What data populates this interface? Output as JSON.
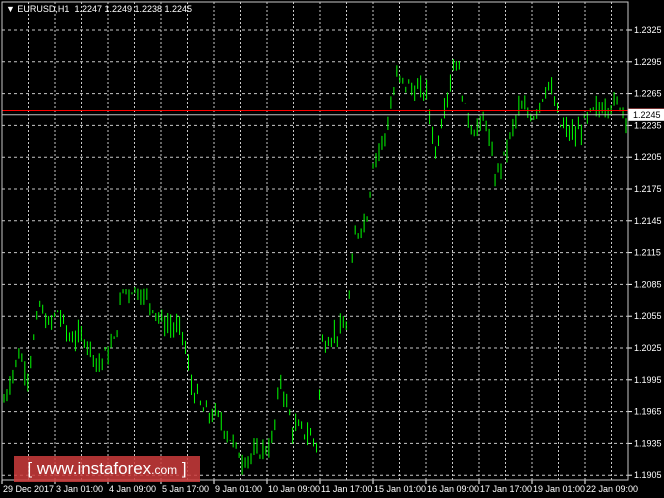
{
  "header": {
    "arrow_icon": "triangle-down",
    "symbol": "EURUSD,H1",
    "ohlc": "1.2247 1.2249 1.2238 1.2245"
  },
  "watermark": {
    "open": "[",
    "site": "www.instaforex",
    "tld": ".com",
    "close": "]"
  },
  "colors": {
    "bars": "#00ff00",
    "grid": "#c8c8c8",
    "ask_line": "#ff0000",
    "bid_line": "#c0c0c0",
    "watermark": "#cd3c3c"
  },
  "chart_data": {
    "type": "bar",
    "title": "EURUSD,H1",
    "ylim": [
      1.1905,
      1.2345
    ],
    "yticks": [
      "1.2325",
      "1.2295",
      "1.2265",
      "1.2235",
      "1.2205",
      "1.2175",
      "1.2145",
      "1.2115",
      "1.2085",
      "1.2055",
      "1.2025",
      "1.1995",
      "1.1965",
      "1.1935",
      "1.1905"
    ],
    "xticks": [
      "29 Dec 2017",
      "3 Jan 01:00",
      "4 Jan 09:00",
      "5 Jan 17:00",
      "9 Jan 01:00",
      "10 Jan 09:00",
      "11 Jan 17:00",
      "15 Jan 01:00",
      "16 Jan 09:00",
      "17 Jan 17:00",
      "19 Jan 01:00",
      "22 Jan 09:00"
    ],
    "current_price": "1.2245",
    "ask_price": 1.2249,
    "total_bars": 209,
    "close_keypoints": [
      [
        0,
        1.1975
      ],
      [
        5,
        1.202
      ],
      [
        8,
        1.2
      ],
      [
        12,
        1.2065
      ],
      [
        15,
        1.2045
      ],
      [
        18,
        1.206
      ],
      [
        22,
        1.2035
      ],
      [
        27,
        1.2035
      ],
      [
        32,
        1.201
      ],
      [
        37,
        1.203
      ],
      [
        40,
        1.208
      ],
      [
        45,
        1.208
      ],
      [
        50,
        1.2065
      ],
      [
        53,
        1.205
      ],
      [
        60,
        1.204
      ],
      [
        63,
        1.199
      ],
      [
        67,
        1.1965
      ],
      [
        72,
        1.196
      ],
      [
        77,
        1.1935
      ],
      [
        80,
        1.192
      ],
      [
        85,
        1.1925
      ],
      [
        90,
        1.1935
      ],
      [
        93,
        1.1995
      ],
      [
        97,
        1.195
      ],
      [
        102,
        1.1945
      ],
      [
        105,
        1.1935
      ],
      [
        107,
        1.203
      ],
      [
        112,
        1.204
      ],
      [
        115,
        1.2045
      ],
      [
        118,
        1.213
      ],
      [
        122,
        1.215
      ],
      [
        124,
        1.22
      ],
      [
        128,
        1.2225
      ],
      [
        132,
        1.228
      ],
      [
        137,
        1.227
      ],
      [
        142,
        1.2265
      ],
      [
        145,
        1.221
      ],
      [
        148,
        1.2255
      ],
      [
        152,
        1.23
      ],
      [
        155,
        1.225
      ],
      [
        158,
        1.223
      ],
      [
        162,
        1.224
      ],
      [
        165,
        1.2185
      ],
      [
        168,
        1.2205
      ],
      [
        173,
        1.225
      ],
      [
        178,
        1.2245
      ],
      [
        183,
        1.2275
      ],
      [
        187,
        1.2235
      ],
      [
        192,
        1.2225
      ],
      [
        197,
        1.2245
      ],
      [
        202,
        1.2255
      ],
      [
        207,
        1.2255
      ],
      [
        209,
        1.2245
      ]
    ]
  }
}
